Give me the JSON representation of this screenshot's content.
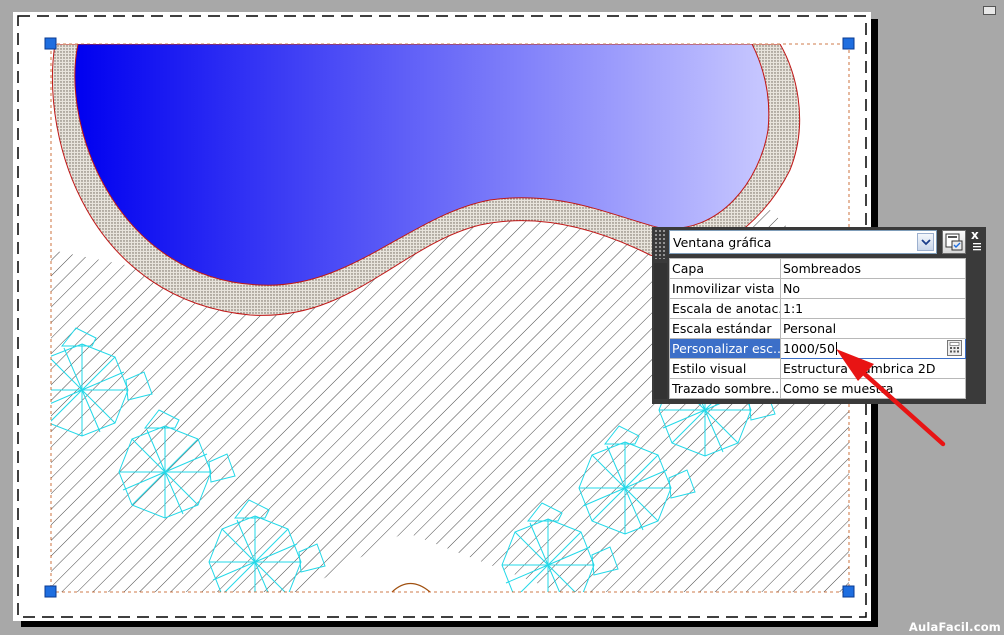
{
  "quick_properties": {
    "object_type": "Ventana gráfica",
    "rows": [
      {
        "label": "Capa",
        "value": "Sombreados"
      },
      {
        "label": "Inmovilizar vista",
        "value": "No"
      },
      {
        "label": "Escala de anotac...",
        "value": "1:1"
      },
      {
        "label": "Escala estándar",
        "value": "Personal"
      },
      {
        "label": "Personalizar esc...",
        "value": "1000/50",
        "selected": true,
        "editing": true
      },
      {
        "label": "Estilo visual",
        "value": "Estructura alámbrica 2D"
      },
      {
        "label": "Trazado sombre...",
        "value": "Como se muestra"
      }
    ],
    "close_label": "x"
  },
  "colors": {
    "water_start": "#0000f0",
    "water_end": "#c8c8ff",
    "tree": "#22d8e8",
    "grip": "#1e6ee0",
    "arrow": "#e81414",
    "selected_row": "#3c6fc8"
  },
  "watermark": "AulaFacil.com",
  "icons": {
    "dropdown": "chevron-down-icon",
    "options": "quick-properties-options-icon",
    "close": "close-icon",
    "calculator": "calculator-icon",
    "grip": "viewport-grip-icon"
  }
}
